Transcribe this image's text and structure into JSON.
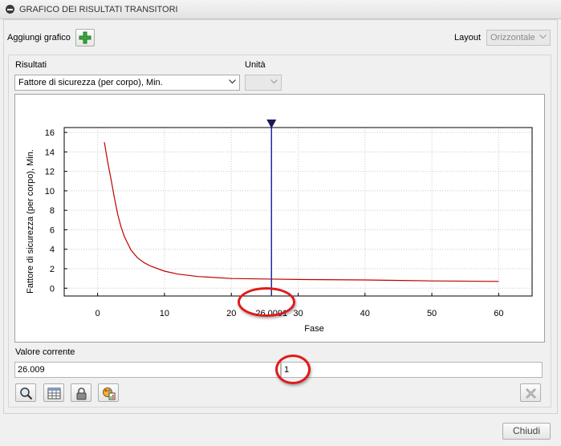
{
  "window": {
    "title": "GRAFICO DEI RISULTATI TRANSITORI"
  },
  "toolbar": {
    "add_chart_label": "Aggiungi grafico",
    "layout_label": "Layout",
    "layout_value": "Orizzontale"
  },
  "results": {
    "results_label": "Risultati",
    "results_value": "Fattore di sicurezza (per corpo), Min.",
    "unit_label": "Unità",
    "unit_value": ""
  },
  "chart_data": {
    "type": "line",
    "xlabel": "Fase",
    "ylabel": "Fattore di sicurezza (per corpo), Min.",
    "xlim": [
      -5,
      65
    ],
    "ylim": [
      -0.8,
      16.5
    ],
    "xticks": [
      0,
      10,
      20,
      30,
      40,
      50,
      60
    ],
    "yticks": [
      0,
      2,
      4,
      6,
      8,
      10,
      12,
      14,
      16
    ],
    "grid": true,
    "series": [
      {
        "color": "#c00000",
        "x": [
          1,
          1.5,
          2,
          2.5,
          3,
          3.5,
          4,
          5,
          6,
          7,
          8,
          10,
          12,
          15,
          20,
          25,
          30,
          40,
          50,
          60
        ],
        "y": [
          15.0,
          13.0,
          11.2,
          9.3,
          7.6,
          6.3,
          5.3,
          3.9,
          3.1,
          2.6,
          2.25,
          1.75,
          1.45,
          1.2,
          1.0,
          0.95,
          0.9,
          0.85,
          0.75,
          0.7
        ]
      }
    ],
    "cursor": {
      "x": 26.0091,
      "label": "26.0091",
      "color": "#1f2aa8"
    }
  },
  "current_value": {
    "label": "Valore corrente",
    "value": "26.009",
    "step": "1"
  },
  "tools": [
    "zoom-icon",
    "table-icon",
    "lock-icon",
    "chart-palette-icon",
    "clear-icon"
  ],
  "footer": {
    "close_label": "Chiudi"
  },
  "colors": {
    "curve": "#c00000",
    "cursor": "#1f2aa8",
    "annotation": "#e0191b",
    "add_icon": "#3aa53a"
  }
}
